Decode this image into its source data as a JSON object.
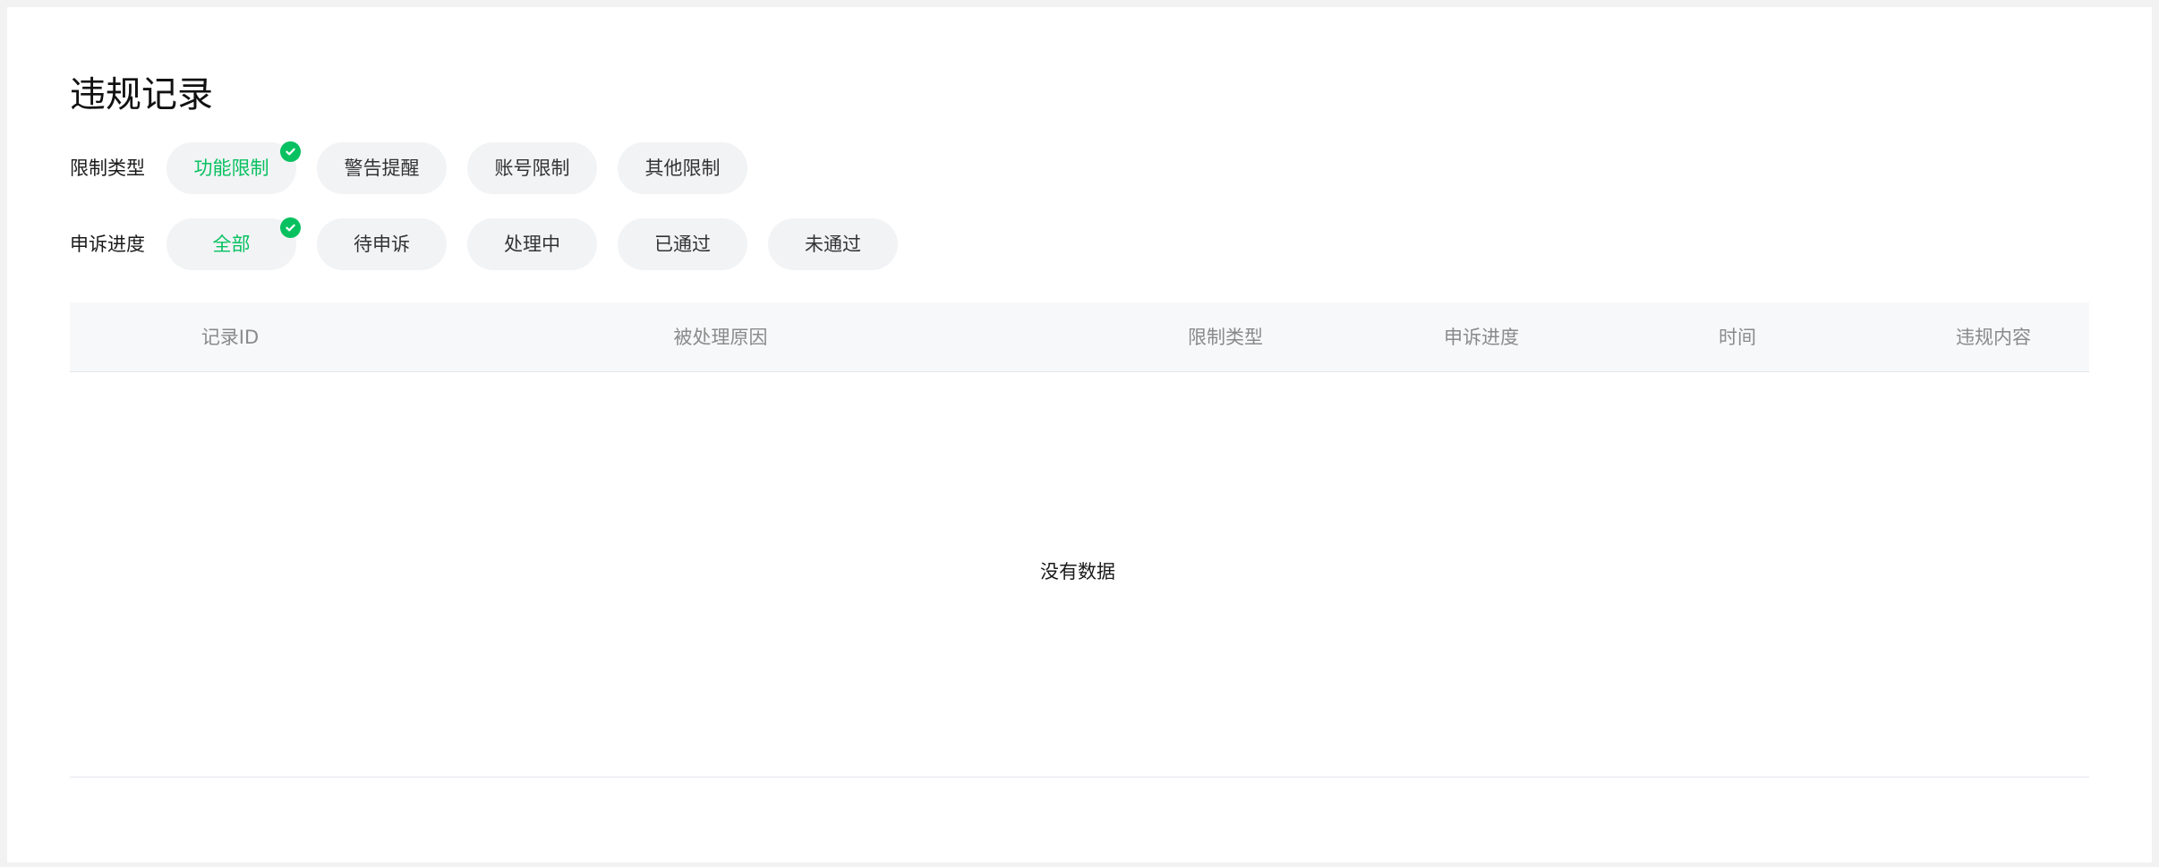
{
  "page": {
    "title": "违规记录"
  },
  "filters": {
    "restriction_type": {
      "label": "限制类型",
      "selected": "功能限制",
      "options": [
        "功能限制",
        "警告提醒",
        "账号限制",
        "其他限制"
      ]
    },
    "appeal_progress": {
      "label": "申诉进度",
      "selected": "全部",
      "options": [
        "全部",
        "待申诉",
        "处理中",
        "已通过",
        "未通过"
      ]
    }
  },
  "table": {
    "columns": [
      "记录ID",
      "被处理原因",
      "限制类型",
      "申诉进度",
      "时间",
      "违规内容"
    ],
    "rows": [],
    "empty_text": "没有数据"
  },
  "colors": {
    "accent": "#07c160",
    "chip_bg": "#f2f3f5",
    "header_bg": "#f7f8fa",
    "header_text": "#8a8a8a"
  },
  "icons": {
    "selected_chip": "check-circle-icon"
  }
}
